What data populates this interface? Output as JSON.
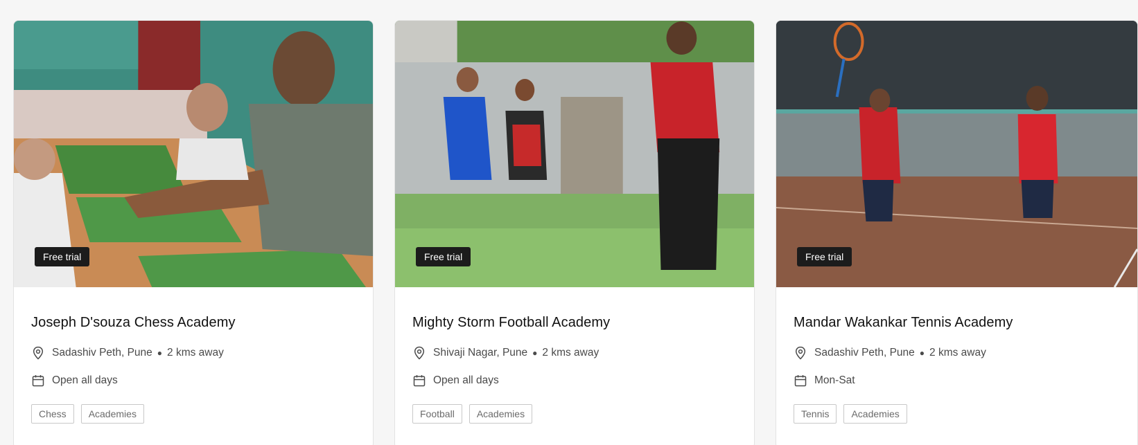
{
  "colors": {
    "badge_bg": "#1c1c1c",
    "card_bg": "#ffffff",
    "tag_border": "#c8c8c8",
    "text_muted": "#4a4a4a"
  },
  "icons": {
    "location": "map-pin-icon",
    "schedule": "calendar-icon"
  },
  "cards": [
    {
      "badge": "Free trial",
      "title": "Joseph D'souza Chess Academy",
      "location": "Sadashiv Peth, Pune",
      "distance": "2 kms away",
      "schedule": "Open all days",
      "tags": [
        "Chess",
        "Academies"
      ]
    },
    {
      "badge": "Free trial",
      "title": "Mighty Storm Football Academy",
      "location": "Shivaji Nagar, Pune",
      "distance": "2 kms away",
      "schedule": "Open all days",
      "tags": [
        "Football",
        "Academies"
      ]
    },
    {
      "badge": "Free trial",
      "title": "Mandar Wakankar Tennis Academy",
      "location": "Sadashiv Peth, Pune",
      "distance": "2 kms away",
      "schedule": "Mon-Sat",
      "tags": [
        "Tennis",
        "Academies"
      ]
    }
  ]
}
